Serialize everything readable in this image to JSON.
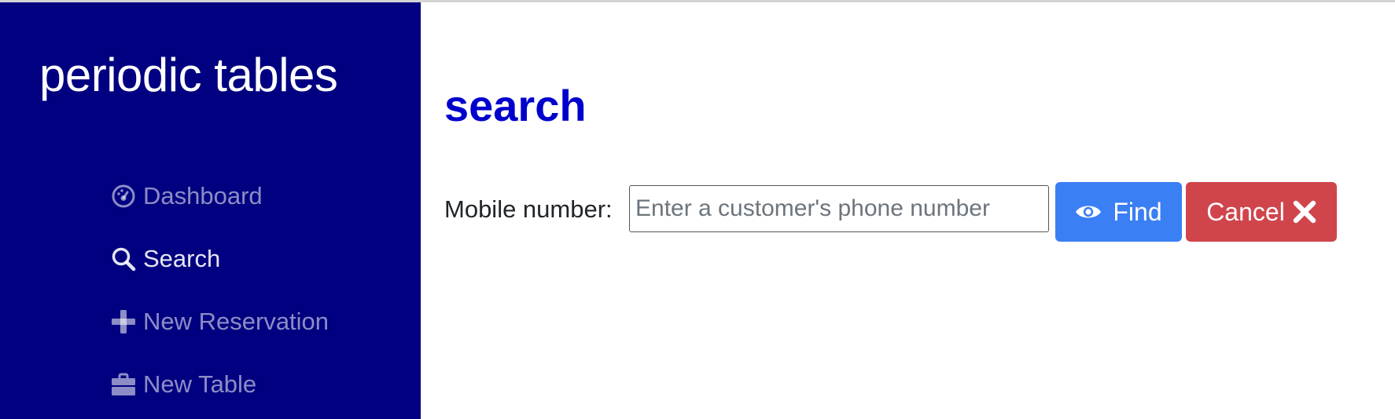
{
  "sidebar": {
    "brand": "periodic tables",
    "items": [
      {
        "label": "Dashboard",
        "icon": "dashboard-gauge-icon",
        "active": false
      },
      {
        "label": "Search",
        "icon": "search-icon",
        "active": true
      },
      {
        "label": "New Reservation",
        "icon": "plus-icon",
        "active": false
      },
      {
        "label": "New Table",
        "icon": "briefcase-icon",
        "active": false
      }
    ]
  },
  "main": {
    "title": "search",
    "form": {
      "label": "Mobile number:",
      "input_value": "",
      "input_placeholder": "Enter a customer's phone number",
      "find_label": "Find",
      "find_icon": "eye-icon",
      "cancel_label": "Cancel",
      "cancel_icon": "x-icon"
    }
  },
  "colors": {
    "sidebar_bg": "#000080",
    "title": "#0000cd",
    "find_button": "#3b7ff5",
    "cancel_button": "#d0454c"
  }
}
